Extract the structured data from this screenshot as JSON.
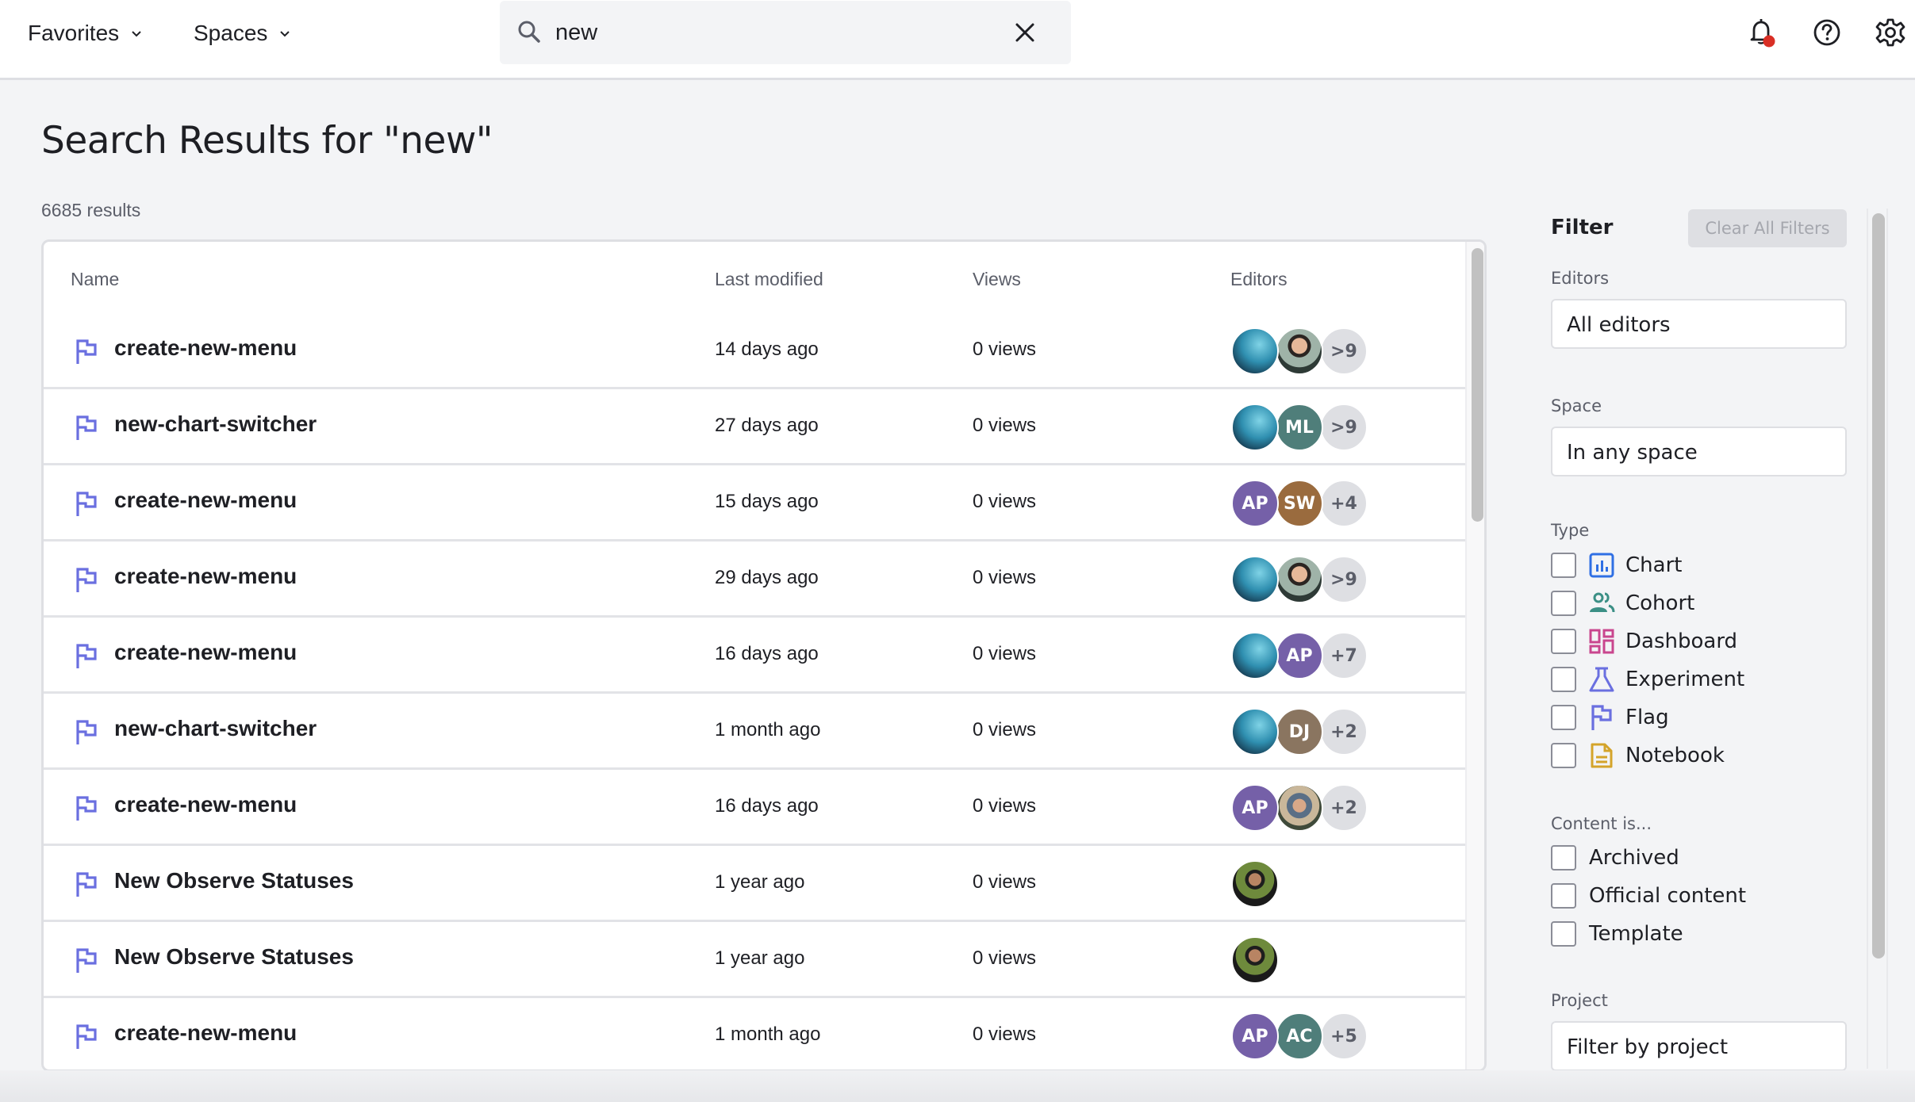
{
  "header": {
    "nav": [
      {
        "label": "Favorites",
        "icon": "chevron-down-icon"
      },
      {
        "label": "Spaces",
        "icon": "chevron-down-icon"
      }
    ],
    "search": {
      "value": "new",
      "icon": "search-icon",
      "clear_icon": "close-icon"
    },
    "icons": [
      "bell-icon",
      "help-icon",
      "gear-icon"
    ],
    "notification_dot_color": "#d92f25"
  },
  "main": {
    "title": "Search Results for \"new\"",
    "result_count": "6685 results",
    "table": {
      "columns": [
        "Name",
        "Last modified",
        "Views",
        "Editors"
      ],
      "rows": [
        {
          "type": "flag",
          "name": "create-new-menu",
          "modified": "14 days ago",
          "views": "0 views",
          "editors": [
            {
              "kind": "photo",
              "style": "aquarium"
            },
            {
              "kind": "photo",
              "style": "man-portrait"
            },
            {
              "kind": "more",
              "label": ">9"
            }
          ]
        },
        {
          "type": "flag",
          "name": "new-chart-switcher",
          "modified": "27 days ago",
          "views": "0 views",
          "editors": [
            {
              "kind": "photo",
              "style": "aquarium"
            },
            {
              "kind": "initials",
              "label": "ML",
              "color": "#4f7e7a"
            },
            {
              "kind": "more",
              "label": ">9"
            }
          ]
        },
        {
          "type": "flag",
          "name": "create-new-menu",
          "modified": "15 days ago",
          "views": "0 views",
          "editors": [
            {
              "kind": "initials",
              "label": "AP",
              "color": "#7560a8"
            },
            {
              "kind": "initials",
              "label": "SW",
              "color": "#9a6b3e"
            },
            {
              "kind": "more",
              "label": "+4"
            }
          ]
        },
        {
          "type": "flag",
          "name": "create-new-menu",
          "modified": "29 days ago",
          "views": "0 views",
          "editors": [
            {
              "kind": "photo",
              "style": "aquarium"
            },
            {
              "kind": "photo",
              "style": "man-portrait"
            },
            {
              "kind": "more",
              "label": ">9"
            }
          ]
        },
        {
          "type": "flag",
          "name": "create-new-menu",
          "modified": "16 days ago",
          "views": "0 views",
          "editors": [
            {
              "kind": "photo",
              "style": "aquarium"
            },
            {
              "kind": "initials",
              "label": "AP",
              "color": "#7560a8"
            },
            {
              "kind": "more",
              "label": "+7"
            }
          ]
        },
        {
          "type": "flag",
          "name": "new-chart-switcher",
          "modified": "1 month ago",
          "views": "0 views",
          "editors": [
            {
              "kind": "photo",
              "style": "aquarium"
            },
            {
              "kind": "initials",
              "label": "DJ",
              "color": "#8a7560"
            },
            {
              "kind": "more",
              "label": "+2"
            }
          ]
        },
        {
          "type": "flag",
          "name": "create-new-menu",
          "modified": "16 days ago",
          "views": "0 views",
          "editors": [
            {
              "kind": "initials",
              "label": "AP",
              "color": "#7560a8"
            },
            {
              "kind": "photo",
              "style": "man-cap"
            },
            {
              "kind": "more",
              "label": "+2"
            }
          ]
        },
        {
          "type": "flag",
          "name": "New Observe Statuses",
          "modified": "1 year ago",
          "views": "0 views",
          "editors": [
            {
              "kind": "photo",
              "style": "man-garden"
            }
          ]
        },
        {
          "type": "flag",
          "name": "New Observe Statuses",
          "modified": "1 year ago",
          "views": "0 views",
          "editors": [
            {
              "kind": "photo",
              "style": "man-garden"
            }
          ]
        },
        {
          "type": "flag",
          "name": "create-new-menu",
          "modified": "1 month ago",
          "views": "0 views",
          "editors": [
            {
              "kind": "initials",
              "label": "AP",
              "color": "#7560a8"
            },
            {
              "kind": "initials",
              "label": "AC",
              "color": "#4f7e7a"
            },
            {
              "kind": "more",
              "label": "+5"
            }
          ]
        }
      ]
    }
  },
  "filter": {
    "title": "Filter",
    "clear_all": "Clear All Filters",
    "editors": {
      "label": "Editors",
      "value": "All editors"
    },
    "space": {
      "label": "Space",
      "value": "In any space"
    },
    "type": {
      "label": "Type",
      "options": [
        {
          "label": "Chart",
          "icon": "chart-icon",
          "color": "#2f6fe4",
          "checked": false
        },
        {
          "label": "Cohort",
          "icon": "cohort-icon",
          "color": "#3b8f85",
          "checked": false
        },
        {
          "label": "Dashboard",
          "icon": "dashboard-icon",
          "color": "#c9468e",
          "checked": false
        },
        {
          "label": "Experiment",
          "icon": "experiment-icon",
          "color": "#6a6fe0",
          "checked": false
        },
        {
          "label": "Flag",
          "icon": "flag-icon",
          "color": "#6a6fe0",
          "checked": false
        },
        {
          "label": "Notebook",
          "icon": "notebook-icon",
          "color": "#d4a42a",
          "checked": false
        }
      ]
    },
    "content": {
      "label": "Content is...",
      "options": [
        {
          "label": "Archived",
          "checked": false
        },
        {
          "label": "Official content",
          "checked": false
        },
        {
          "label": "Template",
          "checked": false
        }
      ]
    },
    "project": {
      "label": "Project",
      "placeholder": "Filter by project"
    }
  },
  "colors": {
    "flag_accent": "#6a6fe0",
    "page_bg": "#f3f4f6",
    "border": "#dedfe3"
  }
}
